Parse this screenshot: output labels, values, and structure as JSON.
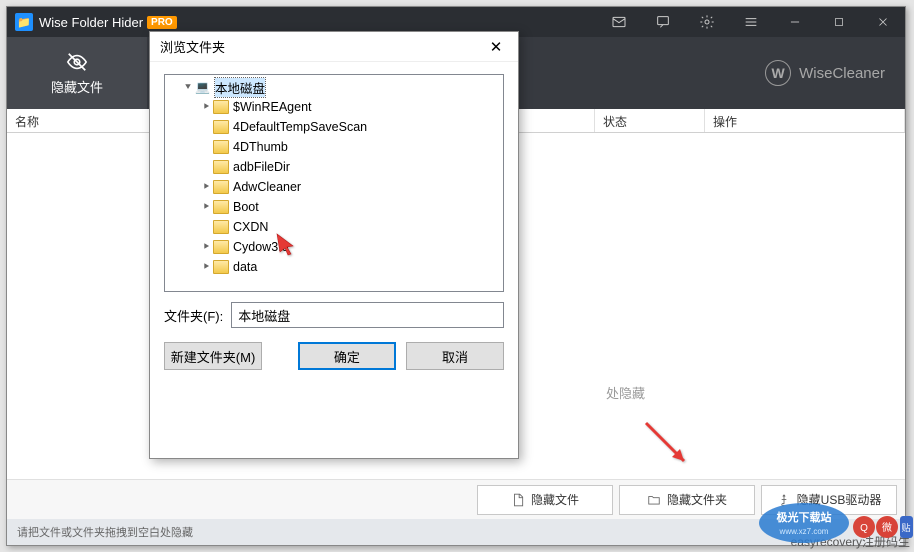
{
  "titlebar": {
    "title": "Wise Folder Hider",
    "pro": "PRO"
  },
  "toolbar": {
    "hide_file_tab": "隐藏文件",
    "brand": "WiseCleaner"
  },
  "columns": {
    "name": "名称",
    "status": "状态",
    "action": "操作"
  },
  "drop_hint": "处隐藏",
  "bottom_actions": {
    "hide_file": "隐藏文件",
    "hide_folder": "隐藏文件夹",
    "hide_usb": "隐藏USB驱动器"
  },
  "status_text": "请把文件或文件夹拖拽到空白处隐藏",
  "dialog": {
    "title": "浏览文件夹",
    "tree": {
      "root": "本地磁盘",
      "items": [
        {
          "label": "$WinREAgent",
          "expandable": true
        },
        {
          "label": "4DefaultTempSaveScan",
          "expandable": false
        },
        {
          "label": "4DThumb",
          "expandable": false
        },
        {
          "label": "adbFileDir",
          "expandable": false
        },
        {
          "label": "AdwCleaner",
          "expandable": true
        },
        {
          "label": "Boot",
          "expandable": true
        },
        {
          "label": "CXDN",
          "expandable": false
        },
        {
          "label": "Cydow3.0",
          "expandable": true
        },
        {
          "label": "data",
          "expandable": true
        }
      ]
    },
    "field_label": "文件夹(F):",
    "field_value": "本地磁盘",
    "new_folder": "新建文件夹(M)",
    "ok": "确定",
    "cancel": "取消"
  },
  "bg_text": "easyrecovery注册码生"
}
